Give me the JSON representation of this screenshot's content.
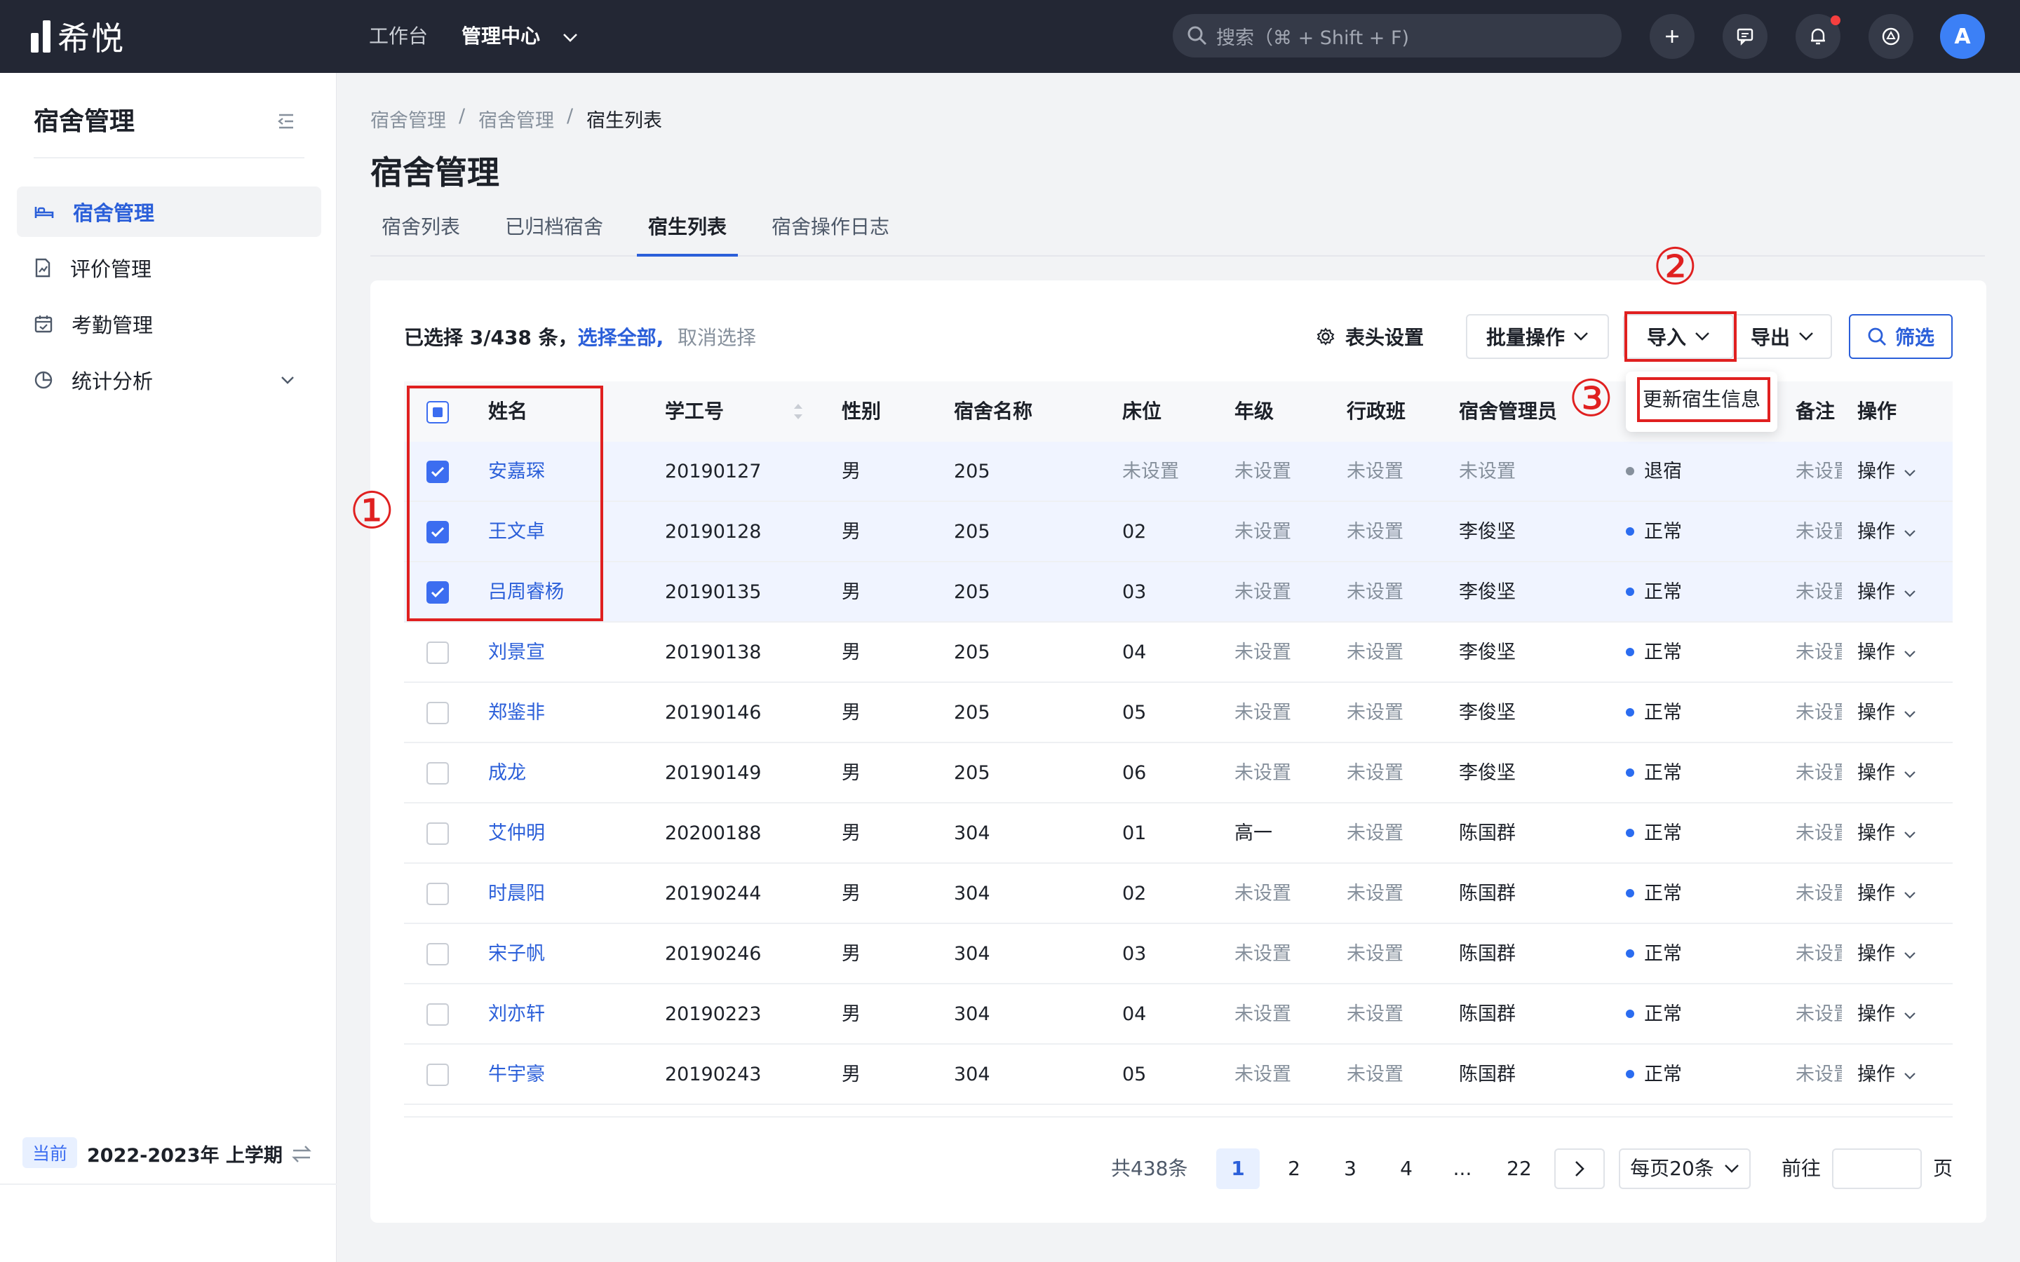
{
  "app": {
    "logo_text": "希悦"
  },
  "topnav": {
    "workbench": "工作台",
    "admin_center": "管理中心"
  },
  "search": {
    "placeholder": "搜索（⌘ + Shift + F)"
  },
  "avatar": {
    "initial": "A"
  },
  "sidebar": {
    "title": "宿舍管理",
    "items": [
      {
        "label": "宿舍管理",
        "active": true
      },
      {
        "label": "评价管理"
      },
      {
        "label": "考勤管理"
      },
      {
        "label": "统计分析"
      }
    ],
    "term_badge": "当前",
    "term": "2022-2023年 上学期"
  },
  "breadcrumb": [
    "宿舍管理",
    "/",
    "宿舍管理",
    "/",
    "宿生列表"
  ],
  "page_title": "宿舍管理",
  "tabs": [
    "宿舍列表",
    "已归档宿舍",
    "宿生列表",
    "宿舍操作日志"
  ],
  "toolbar": {
    "selected_text": "已选择 3/438 条，",
    "select_all": "选择全部,",
    "cancel_select": "取消选择",
    "header_settings": "表头设置",
    "batch": "批量操作",
    "import": "导入",
    "export": "导出",
    "filter": "筛选",
    "import_menu_item": "更新宿生信息"
  },
  "annotations": [
    "①",
    "②",
    "③"
  ],
  "table": {
    "headers": [
      "姓名",
      "学工号",
      "性别",
      "宿舍名称",
      "床位",
      "年级",
      "行政班",
      "宿舍管理员",
      "备注",
      "操作"
    ],
    "rows": [
      {
        "checked": true,
        "name": "安嘉琛",
        "id": "20190127",
        "gender": "男",
        "dorm": "205",
        "bed": "未设置",
        "grade": "未设置",
        "klass": "未设置",
        "admin": "未设置",
        "status": "退宿",
        "note": "未设置",
        "op": "操作"
      },
      {
        "checked": true,
        "name": "王文卓",
        "id": "20190128",
        "gender": "男",
        "dorm": "205",
        "bed": "02",
        "grade": "未设置",
        "klass": "未设置",
        "admin": "李俊坚",
        "status": "正常",
        "note": "未设置",
        "op": "操作"
      },
      {
        "checked": true,
        "name": "吕周睿杨",
        "id": "20190135",
        "gender": "男",
        "dorm": "205",
        "bed": "03",
        "grade": "未设置",
        "klass": "未设置",
        "admin": "李俊坚",
        "status": "正常",
        "note": "未设置",
        "op": "操作"
      },
      {
        "checked": false,
        "name": "刘景宣",
        "id": "20190138",
        "gender": "男",
        "dorm": "205",
        "bed": "04",
        "grade": "未设置",
        "klass": "未设置",
        "admin": "李俊坚",
        "status": "正常",
        "note": "未设置",
        "op": "操作"
      },
      {
        "checked": false,
        "name": "郑鉴非",
        "id": "20190146",
        "gender": "男",
        "dorm": "205",
        "bed": "05",
        "grade": "未设置",
        "klass": "未设置",
        "admin": "李俊坚",
        "status": "正常",
        "note": "未设置",
        "op": "操作"
      },
      {
        "checked": false,
        "name": "成龙",
        "id": "20190149",
        "gender": "男",
        "dorm": "205",
        "bed": "06",
        "grade": "未设置",
        "klass": "未设置",
        "admin": "李俊坚",
        "status": "正常",
        "note": "未设置",
        "op": "操作"
      },
      {
        "checked": false,
        "name": "艾仲明",
        "id": "20200188",
        "gender": "男",
        "dorm": "304",
        "bed": "01",
        "grade": "高一",
        "klass": "未设置",
        "admin": "陈国群",
        "status": "正常",
        "note": "未设置",
        "op": "操作"
      },
      {
        "checked": false,
        "name": "时晨阳",
        "id": "20190244",
        "gender": "男",
        "dorm": "304",
        "bed": "02",
        "grade": "未设置",
        "klass": "未设置",
        "admin": "陈国群",
        "status": "正常",
        "note": "未设置",
        "op": "操作"
      },
      {
        "checked": false,
        "name": "宋子帆",
        "id": "20190246",
        "gender": "男",
        "dorm": "304",
        "bed": "03",
        "grade": "未设置",
        "klass": "未设置",
        "admin": "陈国群",
        "status": "正常",
        "note": "未设置",
        "op": "操作"
      },
      {
        "checked": false,
        "name": "刘亦轩",
        "id": "20190223",
        "gender": "男",
        "dorm": "304",
        "bed": "04",
        "grade": "未设置",
        "klass": "未设置",
        "admin": "陈国群",
        "status": "正常",
        "note": "未设置",
        "op": "操作"
      },
      {
        "checked": false,
        "name": "牛宇豪",
        "id": "20190243",
        "gender": "男",
        "dorm": "304",
        "bed": "05",
        "grade": "未设置",
        "klass": "未设置",
        "admin": "陈国群",
        "status": "正常",
        "note": "未设置",
        "op": "操作"
      }
    ]
  },
  "pagination": {
    "total": "共438条",
    "pages": [
      "1",
      "2",
      "3",
      "4",
      "...",
      "22"
    ],
    "current": "1",
    "page_size": "每页20条",
    "goto_prefix": "前往",
    "goto_suffix": "页"
  },
  "colors": {
    "brand": "#2b5fd9",
    "checkbox": "#3c6df0",
    "annotation": "#e02020",
    "status_normal": "#2b6cf0",
    "status_left": "#86909c"
  }
}
